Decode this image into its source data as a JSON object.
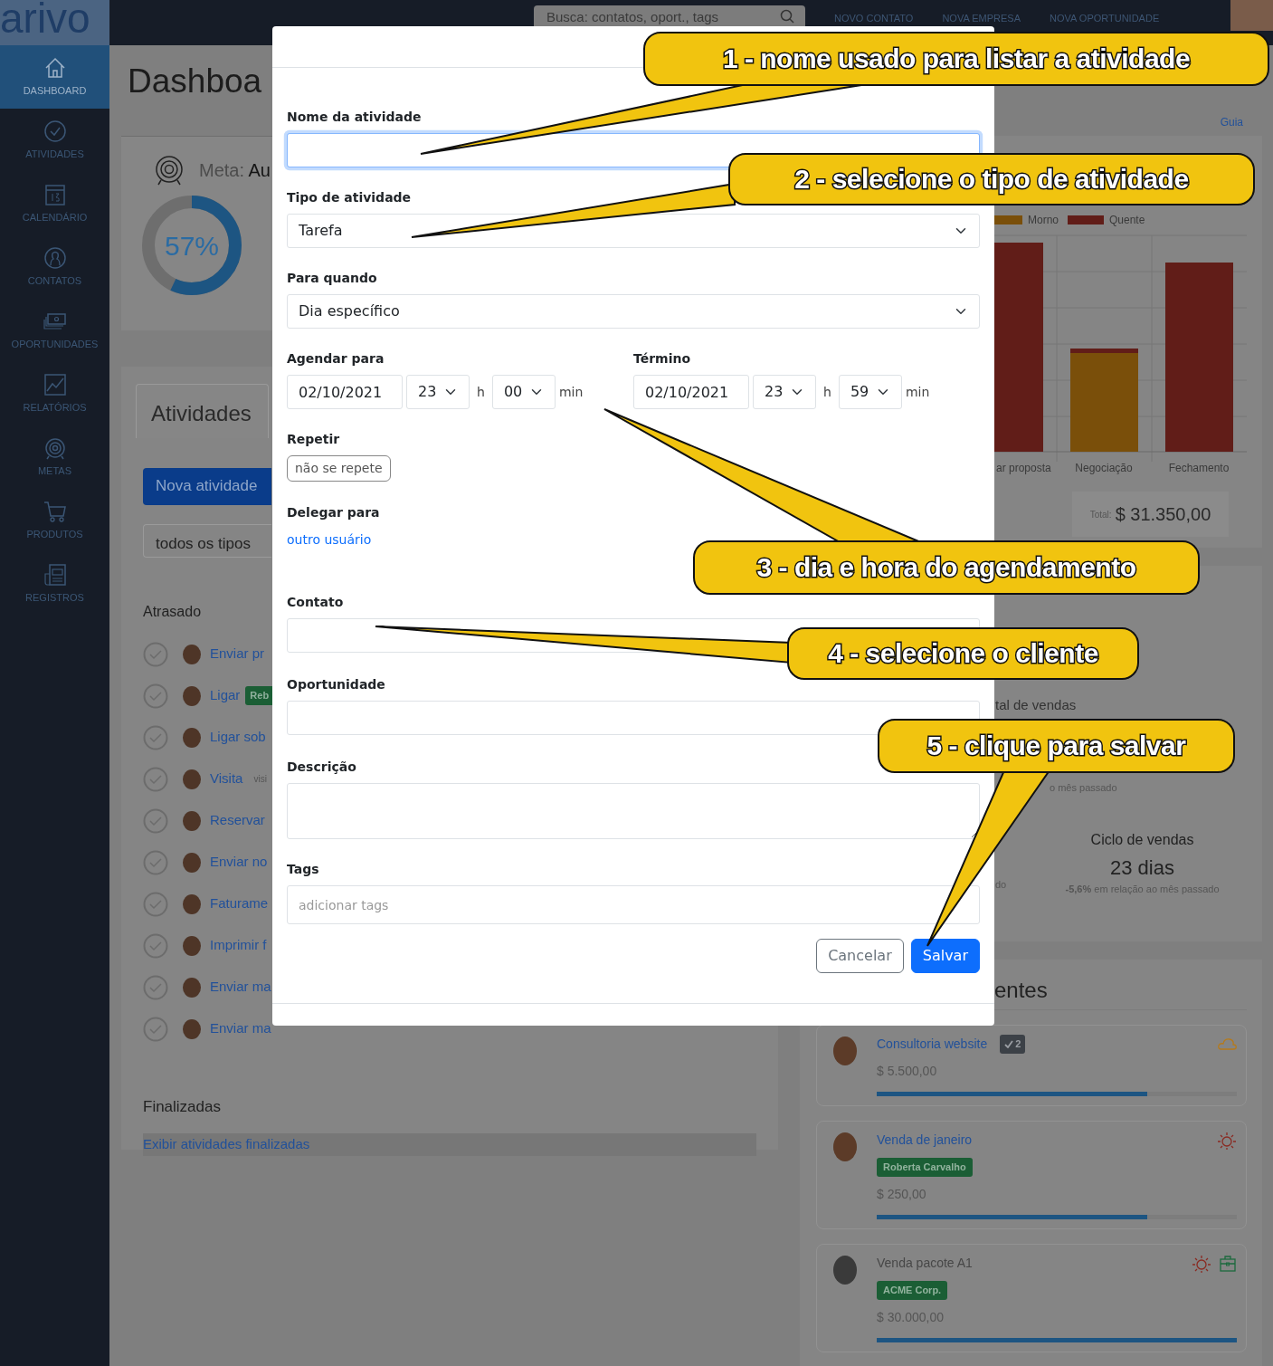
{
  "topbar": {
    "logo": "arivo",
    "search": {
      "placeholder": "Busca: contatos, oport., tags"
    },
    "links": [
      "NOVO CONTATO",
      "NOVA EMPRESA",
      "NOVA OPORTUNIDADE"
    ]
  },
  "sidebar": {
    "items": [
      {
        "label": "DASHBOARD",
        "selected": true
      },
      {
        "label": "ATIVIDADES",
        "selected": false
      },
      {
        "label": "CALENDÁRIO",
        "selected": false
      },
      {
        "label": "CONTATOS",
        "selected": false
      },
      {
        "label": "OPORTUNIDADES",
        "selected": false
      },
      {
        "label": "RELATÓRIOS",
        "selected": false
      },
      {
        "label": "METAS",
        "selected": false
      },
      {
        "label": "PRODUTOS",
        "selected": false
      },
      {
        "label": "REGISTROS",
        "selected": false
      }
    ]
  },
  "page": {
    "title": "Dashboa",
    "guide_link": "Guia"
  },
  "goal": {
    "label": "Meta:",
    "name": "Au",
    "percent": "57%",
    "level": 0.57
  },
  "activities": {
    "tab": "Atividades",
    "new_button": "Nova atividade",
    "type_filter": "todos os tipos",
    "overdue_heading": "Atrasado",
    "rows": [
      {
        "title": "Enviar pr"
      },
      {
        "title": "Ligar",
        "tag": "Reb"
      },
      {
        "title": "Ligar sob"
      },
      {
        "title": "Visita",
        "note": "visi"
      },
      {
        "title": "Reservar"
      },
      {
        "title": "Enviar no"
      },
      {
        "title": "Faturame"
      },
      {
        "title": "Imprimir f"
      },
      {
        "title": "Enviar ma"
      },
      {
        "title": "Enviar ma"
      }
    ],
    "finished_heading": "Finalizadas",
    "show_finished_link": "Exibir atividades finalizadas"
  },
  "pipeline_chart": {
    "legend": [
      {
        "label": "Morno",
        "color": "#7a4f0a"
      },
      {
        "label": "Quente",
        "color": "#611d18"
      }
    ],
    "categories": [
      "ar proposta",
      "Negociação",
      "Fechamento"
    ],
    "total_label": "Total:",
    "total": "$ 31.350,00"
  },
  "stats": {
    "fragments": [
      "tal de vendas",
      "o mês passado",
      "do"
    ],
    "cycle": {
      "title": "Ciclo de vendas",
      "value": "23 dias",
      "change": "**-5,6%** em relação ao mês passado"
    }
  },
  "opportunities": {
    "heading": "entes",
    "cards": [
      {
        "title": "Consultoria website",
        "muted": false,
        "count": "2",
        "value": "$ 5.500,00",
        "level": 0.75,
        "hot": false,
        "company": false
      },
      {
        "title": "Venda de janeiro",
        "muted": false,
        "tag": "Roberta Carvalho",
        "value": "$ 250,00",
        "level": 0.75,
        "hot": true,
        "company": false
      },
      {
        "title": "Venda pacote A1",
        "muted": true,
        "tag": "ACME Corp.",
        "value": "$ 30.000,00",
        "level": 1.0,
        "hot": true,
        "company": true
      }
    ]
  },
  "modal": {
    "name": {
      "label": "Nome da atividade",
      "focused": true
    },
    "type": {
      "label": "Tipo de atividade",
      "value": "Tarefa"
    },
    "when": {
      "label": "Para quando",
      "value": "Dia específico"
    },
    "schedule": [
      {
        "label": "Agendar para",
        "date": "02/10/2021",
        "hour": "23",
        "hour_unit": "h",
        "minute": "00",
        "minute_unit": "min"
      },
      {
        "label": "Término",
        "date": "02/10/2021",
        "hour": "23",
        "hour_unit": "h",
        "minute": "59",
        "minute_unit": "min"
      }
    ],
    "repeat": {
      "label": "Repetir",
      "button": "não se repete"
    },
    "delegate": {
      "label": "Delegar para",
      "link": "outro usuário"
    },
    "contact": {
      "label": "Contato"
    },
    "opportunity": {
      "label": "Oportunidade"
    },
    "description": {
      "label": "Descrição"
    },
    "tags": {
      "label": "Tags",
      "placeholder": "adicionar tags"
    },
    "buttons": {
      "cancel": "Cancelar",
      "save": "Salvar"
    }
  },
  "callouts": [
    "1 - nome usado para listar a atividade",
    "2 - selecione o tipo de atividade",
    "3 - dia e hora do agendamento",
    "4 - selecione o cliente",
    "5 - clique para salvar"
  ]
}
